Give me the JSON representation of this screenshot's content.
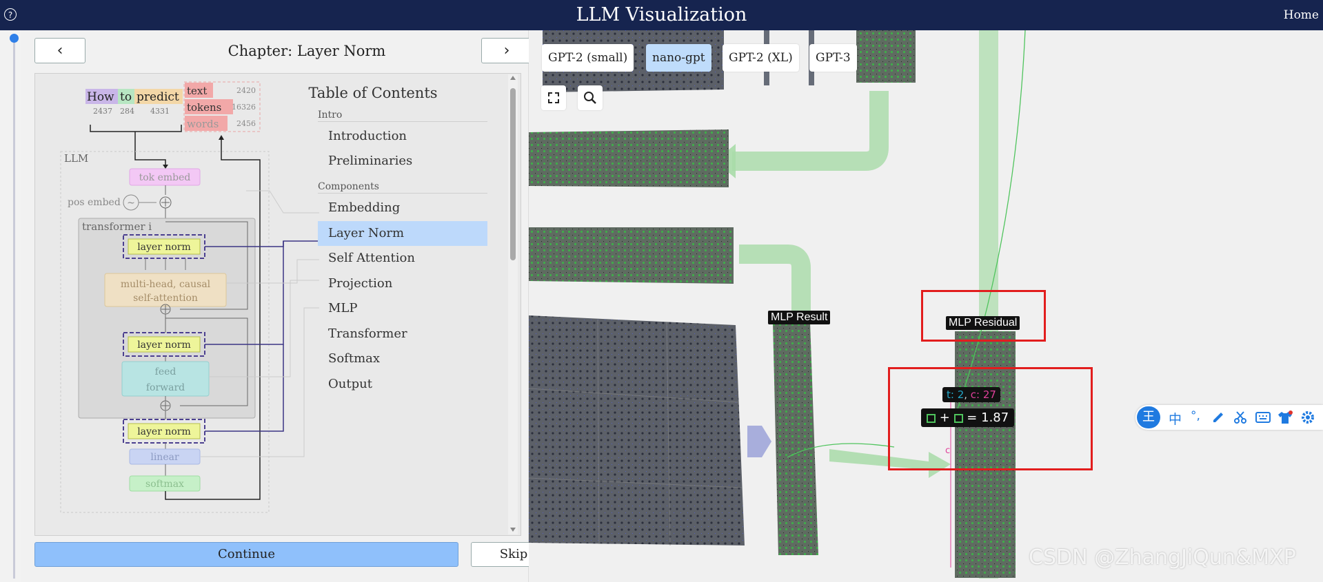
{
  "header": {
    "title": "LLM Visualization",
    "help_icon": "?",
    "home_label": "Home"
  },
  "walkthrough": {
    "chapter_title": "Chapter: Layer Norm",
    "prev_glyph": "‹",
    "next_glyph": "›",
    "continue_label": "Continue",
    "skip_label": "Skip"
  },
  "diagram": {
    "tokens": [
      {
        "word": "How",
        "id": "2437",
        "color": "#c9b6e8"
      },
      {
        "word": "to",
        "id": "284",
        "color": "#b7e6c2"
      },
      {
        "word": "predict",
        "id": "4331",
        "color": "#f3d7a7"
      }
    ],
    "stats": [
      {
        "label": "text",
        "value": "2420"
      },
      {
        "label": "tokens",
        "value": "16326"
      },
      {
        "label": "words",
        "value": "2456"
      }
    ],
    "llm_label": "LLM",
    "tok_embed": "tok embed",
    "pos_embed": "pos embed",
    "transformer_label": "transformer i",
    "layer_norm": "layer norm",
    "attention_line1": "multi-head, causal",
    "attention_line2": "self-attention",
    "ff_line1": "feed",
    "ff_line2": "forward",
    "linear": "linear",
    "softmax": "softmax"
  },
  "toc": {
    "title": "Table of Contents",
    "sections": [
      {
        "name": "Intro",
        "items": [
          "Introduction",
          "Preliminaries"
        ]
      },
      {
        "name": "Components",
        "items": [
          "Embedding",
          "Layer Norm",
          "Self Attention",
          "Projection",
          "MLP",
          "Transformer",
          "Softmax",
          "Output"
        ]
      }
    ],
    "active_item": "Layer Norm"
  },
  "canvas": {
    "models": [
      "GPT-2 (small)",
      "nano-gpt",
      "GPT-2 (XL)",
      "GPT-3"
    ],
    "active_model": "nano-gpt",
    "mlp_result_label": "MLP Result",
    "mlp_residual_label": "MLP Residual",
    "tooltip": {
      "t_label": "t: 2",
      "c_label": "c: 27",
      "formula_ops": "+",
      "equals": "=",
      "value": "1.87"
    },
    "axis_c_label": "c",
    "colors": {
      "accent_green": "#a8dba8",
      "matrix_grey": "#5d665f",
      "highlight_red": "#e21d1d",
      "t_color": "#22a7c9",
      "c_color": "#e0409a"
    }
  },
  "ime_toolbar": {
    "brand": "王",
    "lang": "中",
    "punct": "°,"
  },
  "watermark": "CSDN @ZhangJiQun&MXP"
}
